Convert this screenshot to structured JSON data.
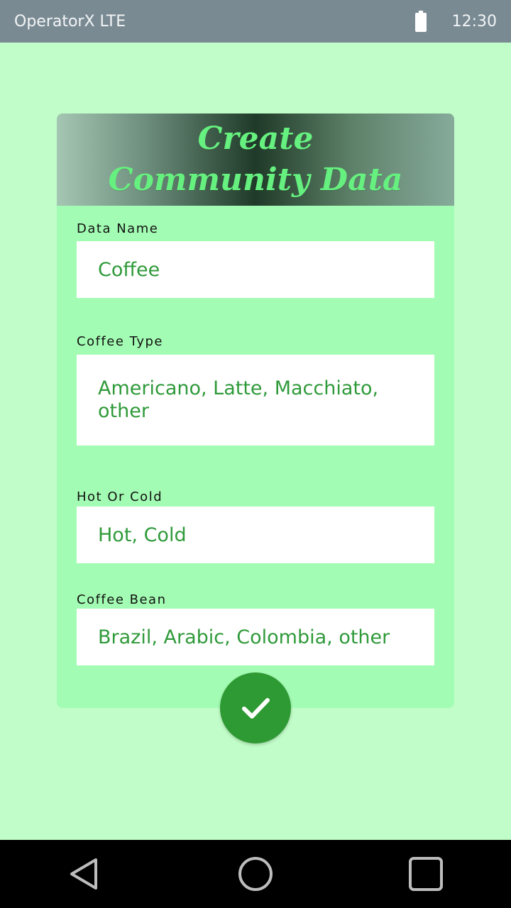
{
  "status_bar": {
    "carrier": "OperatorX LTE",
    "time": "12:30",
    "battery_icon": "battery-full-icon"
  },
  "header": {
    "title_line1": "Create",
    "title_line2": "Community Data"
  },
  "fields": [
    {
      "label": "Data Name",
      "value": "Coffee"
    },
    {
      "label": "Coffee Type",
      "value": "Americano, Latte, Macchiato, other"
    },
    {
      "label": "Hot Or Cold",
      "value": "Hot, Cold"
    },
    {
      "label": "Coffee Bean",
      "value": "Brazil, Arabic, Colombia, other"
    }
  ],
  "fab": {
    "icon": "checkmark-icon",
    "color": "#2e9a33"
  },
  "nav": {
    "back_icon": "back-triangle-icon",
    "home_icon": "home-circle-icon",
    "recents_icon": "recents-square-icon"
  },
  "colors": {
    "background": "#c1fdc8",
    "card": "#a3fcb3",
    "value_text": "#2f9a3a",
    "title_text": "#66f07f"
  }
}
